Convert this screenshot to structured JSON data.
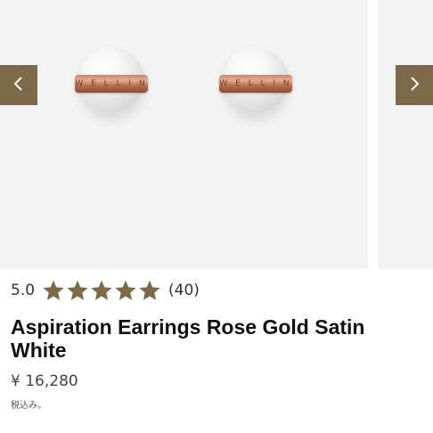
{
  "gallery": {
    "prev_arrow": "chevron-left-icon",
    "next_arrow": "chevron-right-icon",
    "band_text": "W E L L I N",
    "colors": {
      "arrow_bg": "#7e6a48",
      "image_bg": "#f3f3f3"
    }
  },
  "product": {
    "rating_value": "5.0",
    "stars": 5,
    "star_color": "#7e6a48",
    "review_count": "(40)",
    "title": "Aspiration Earrings Rose Gold Satin White",
    "price": "¥ 16,280",
    "tax_note": "税込み。"
  }
}
